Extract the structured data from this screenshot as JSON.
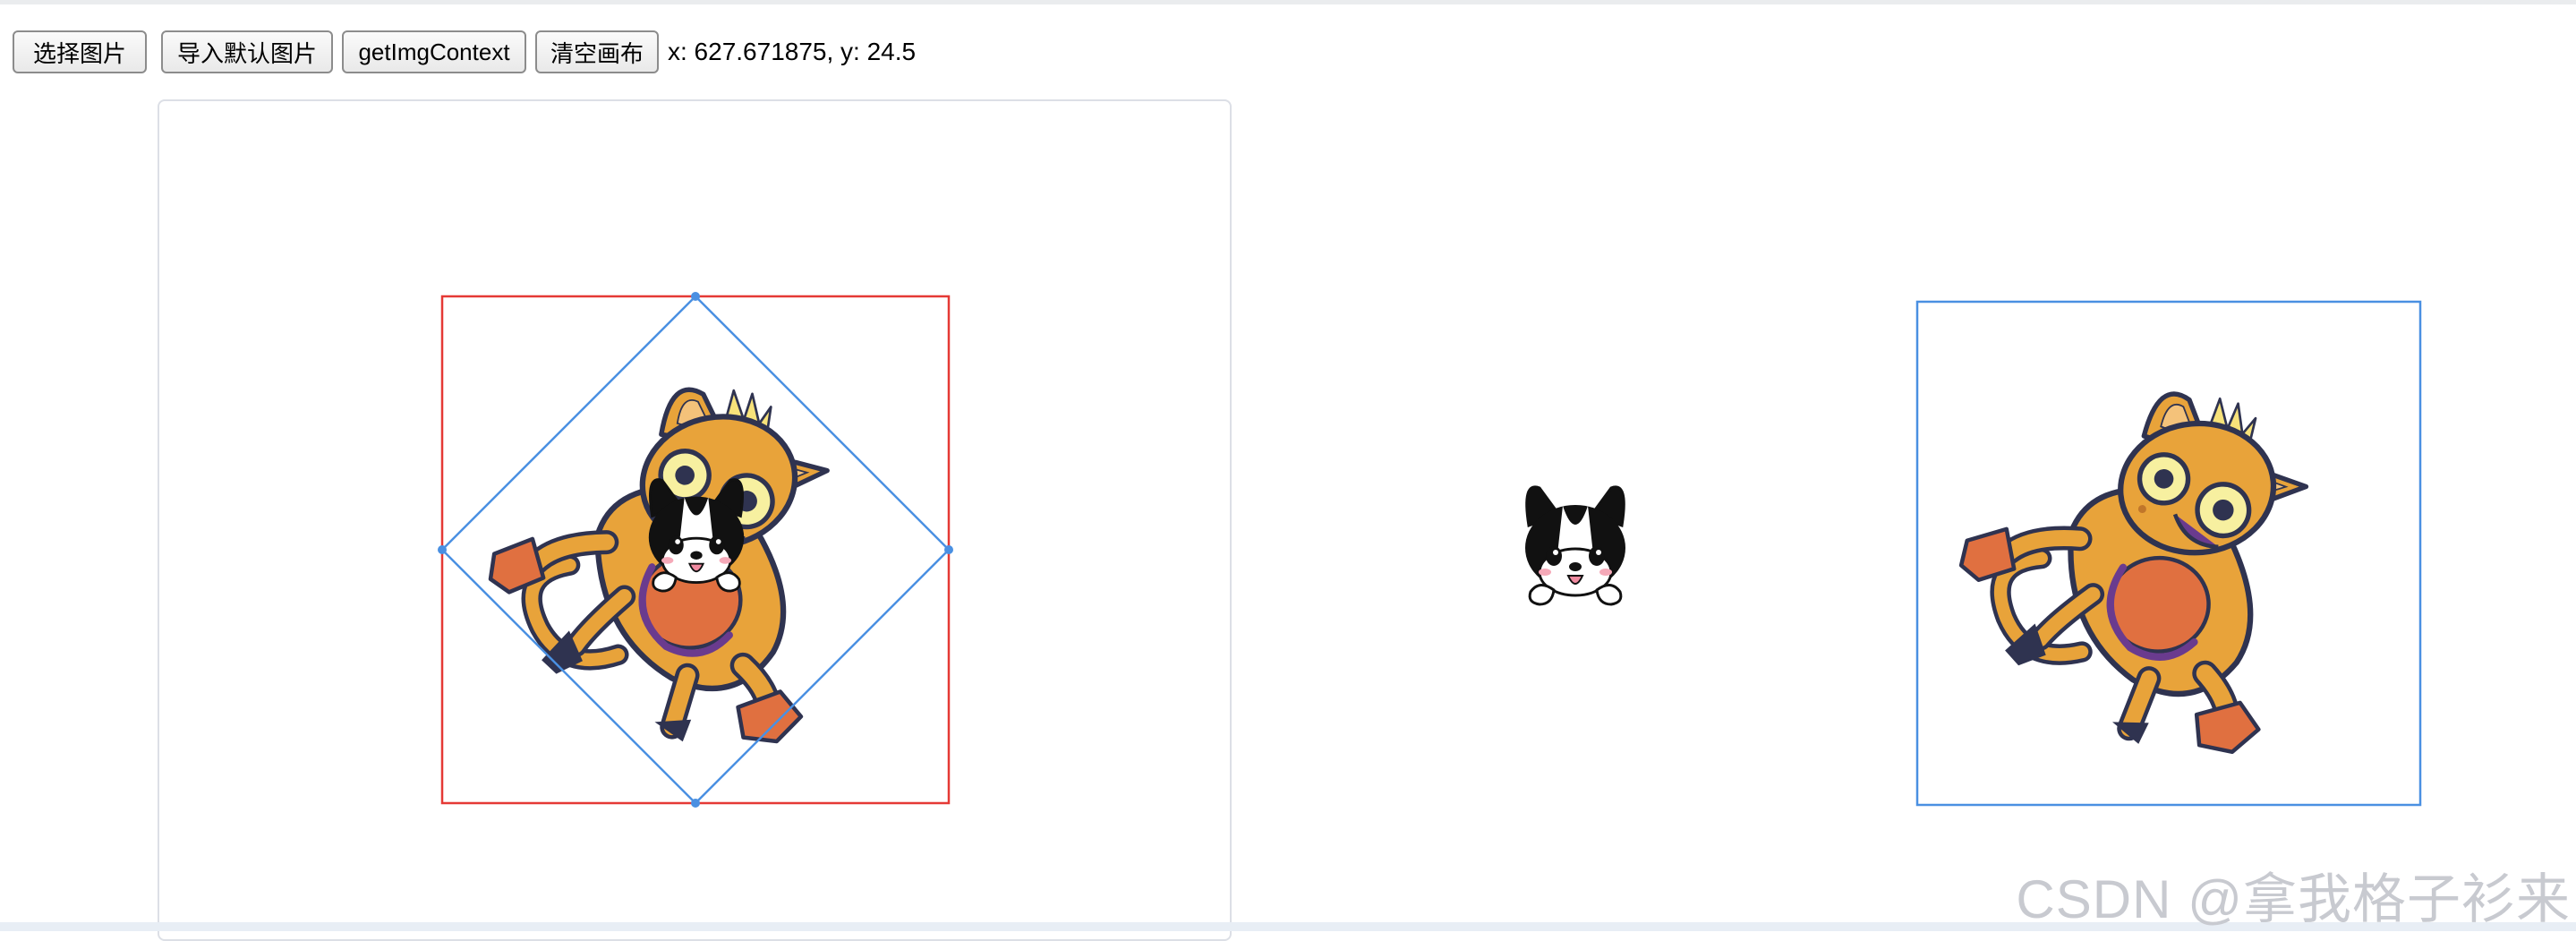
{
  "toolbar": {
    "select_image_label": "选择图片",
    "import_default_label": "导入默认图片",
    "get_img_context_label": "getImgContext",
    "clear_canvas_label": "清空画布",
    "coords_text": "x: 627.671875, y: 24.5"
  },
  "colors": {
    "selection_rect": "#e53935",
    "rotation_frame": "#4a90e2",
    "preview_frame": "#4a90e2",
    "cat_body": "#e8a33a",
    "cat_belly": "#e07040",
    "outline": "#2f3350"
  },
  "canvas": {
    "rotation_degrees": 45
  },
  "watermark": {
    "text": "CSDN @拿我格子衫来"
  },
  "icons": {
    "cat": "cartoon-cat-image",
    "dog": "cartoon-dog-sticker"
  }
}
